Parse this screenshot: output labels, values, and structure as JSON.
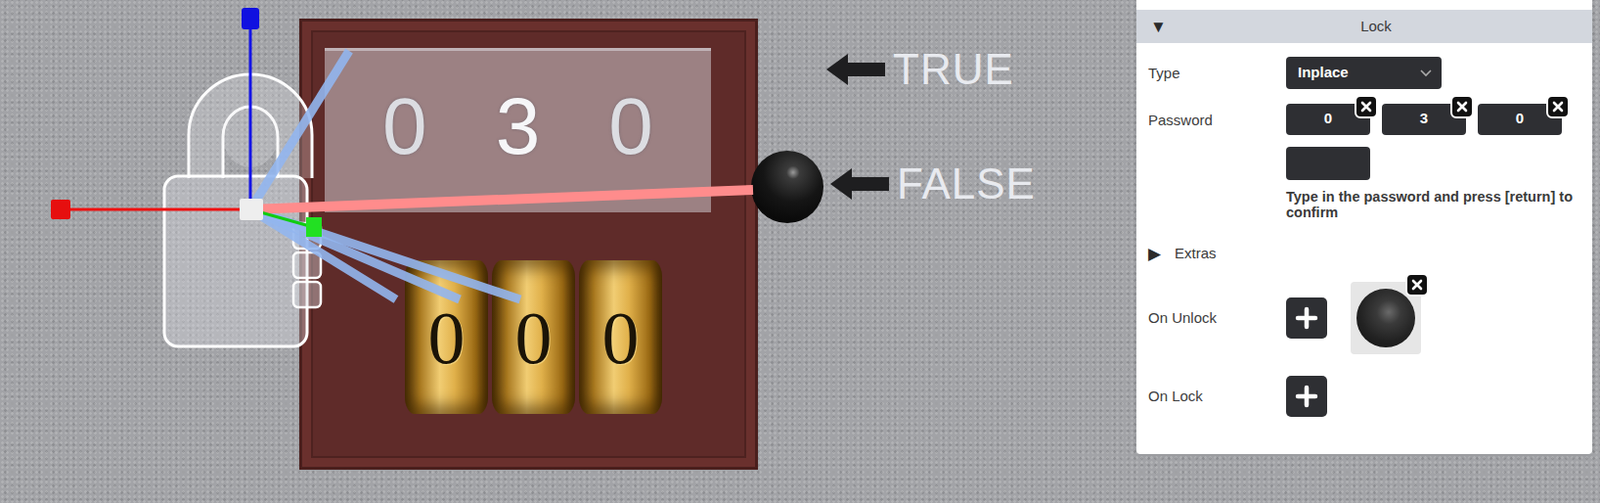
{
  "scene": {
    "lock": {
      "selected": true
    },
    "display": [
      "0",
      "3",
      "0"
    ],
    "dials": [
      "0",
      "0",
      "0"
    ],
    "labels": [
      "TRUE",
      "FALSE"
    ]
  },
  "panel": {
    "header": {
      "toggle": "▼",
      "title": "Lock",
      "expanded": true
    },
    "type": {
      "label": "Type",
      "value": "Inplace"
    },
    "password": {
      "label": "Password",
      "digits": [
        "0",
        "3",
        "0"
      ],
      "input": "",
      "hint": "Type in the password and press [return] to confirm"
    },
    "extras": {
      "toggle": "▶",
      "label": "Extras",
      "expanded": false
    },
    "on_unlock": {
      "label": "On Unlock",
      "targets": [
        {
          "kind": "sphere"
        }
      ]
    },
    "on_lock": {
      "label": "On Lock",
      "targets": []
    }
  }
}
